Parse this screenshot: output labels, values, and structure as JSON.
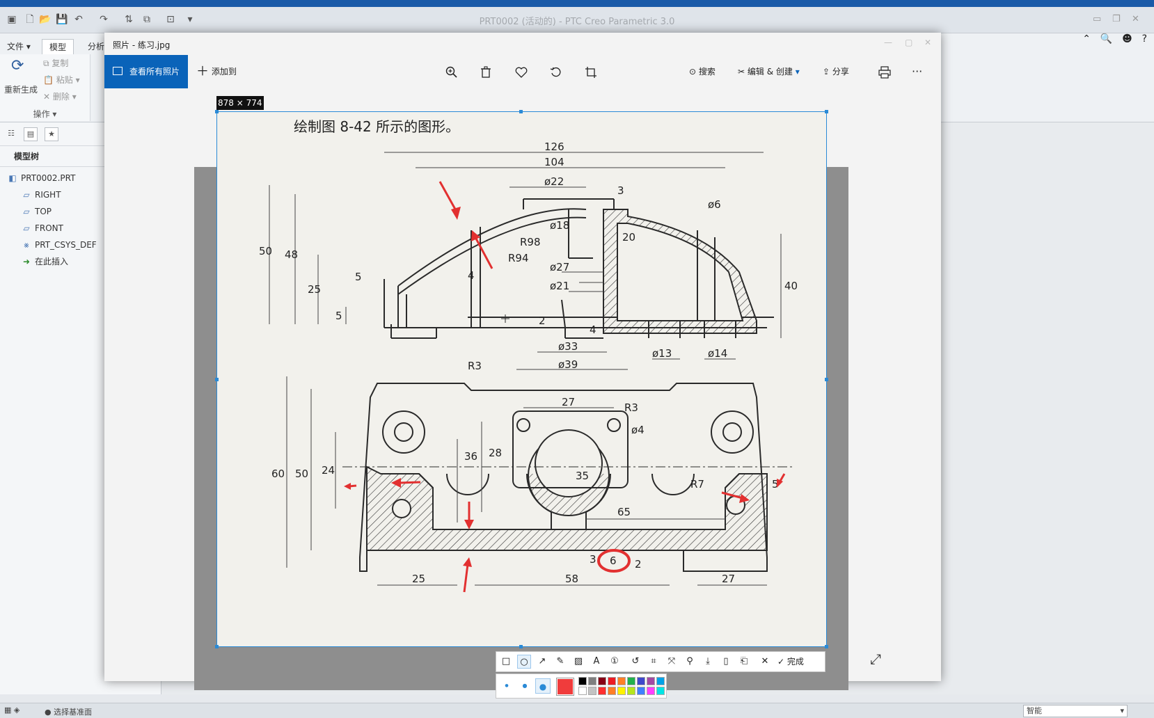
{
  "creo": {
    "title": "PRT0002 (活动的) - PTC Creo Parametric 3.0",
    "tabs": [
      "文件",
      "模型",
      "分析"
    ],
    "active_tab": "模型",
    "regenerate_label": "重新生成",
    "copy_label": "复制",
    "paste_label": "粘贴",
    "delete_label": "删除",
    "operations_label": "操作",
    "model_tree_label": "模型树",
    "tree_items": [
      "PRT0002.PRT",
      "RIGHT",
      "TOP",
      "FRONT",
      "PRT_CSYS_DEF",
      "在此插入"
    ],
    "status_text": "● 选择基准面",
    "status_right": "智能"
  },
  "photos": {
    "window_title": "照片 - 练习.jpg",
    "view_all_label": "查看所有照片",
    "add_to_label": "添加到",
    "search_label": "搜索",
    "edit_create_label": "编辑 & 创建",
    "share_label": "分享",
    "more_label": "···"
  },
  "snip": {
    "size_label": "878 × 774",
    "done_label": "完成",
    "current_color": "#f03c3c",
    "palette": [
      "#000000",
      "#7f7f7f",
      "#880015",
      "#ed1c24",
      "#ff7f27",
      "#22b14c",
      "#3f48cc",
      "#a349a4",
      "#00a2e8",
      "#ffffff",
      "#c3c3c3",
      "#ff3030",
      "#ff7f27",
      "#fff200",
      "#b5e61d",
      "#3f7fff",
      "#ff40ff",
      "#00e5e5"
    ]
  },
  "drawing": {
    "heading": "绘制图 8-42 所示的图形。",
    "dims": [
      "126",
      "104",
      "ø22",
      "3",
      "ø6",
      "ø18",
      "20",
      "R98",
      "R94",
      "50",
      "48",
      "25",
      "5",
      "5",
      "4",
      "ø27",
      "ø21",
      "40",
      "2",
      "4",
      "ø33",
      "ø39",
      "ø13",
      "ø14",
      "R3",
      "27",
      "R3",
      "ø4",
      "60",
      "50",
      "24",
      "36",
      "28",
      "35",
      "R7",
      "5",
      "65",
      "3",
      "6",
      "2",
      "25",
      "58",
      "27"
    ]
  }
}
